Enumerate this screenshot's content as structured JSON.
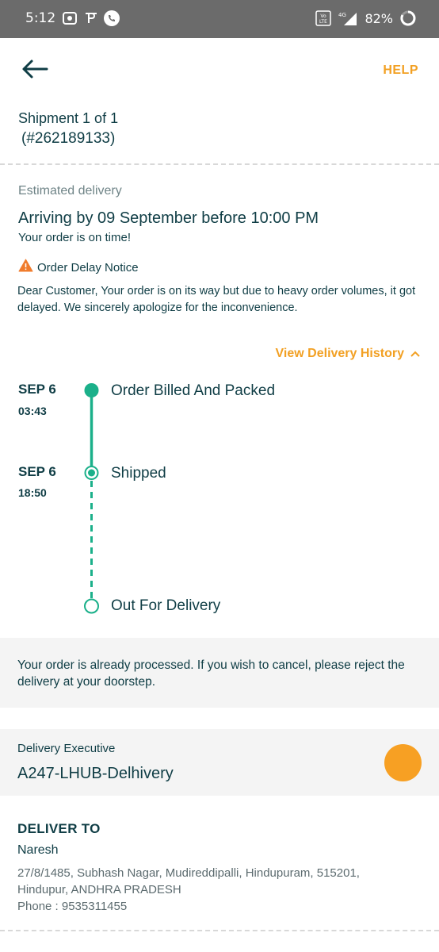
{
  "status_bar": {
    "time": "5:12",
    "battery": "82%",
    "network": "4G"
  },
  "header": {
    "help_label": "HELP"
  },
  "shipment": {
    "line1": "Shipment 1 of 1",
    "line2": "(#262189133)"
  },
  "delivery": {
    "label": "Estimated delivery",
    "arriving": "Arriving by 09 September before 10:00 PM",
    "status": "Your order is on time!"
  },
  "notice": {
    "title": "Order Delay Notice",
    "body": "Dear Customer, Your order is on its way but due to heavy order volumes, it got delayed. We sincerely apologize for the inconvenience."
  },
  "history": {
    "toggle_label": "View Delivery History",
    "steps": [
      {
        "date": "SEP 6",
        "time": "03:43",
        "label": "Order Billed And Packed",
        "state": "done"
      },
      {
        "date": "SEP 6",
        "time": "18:50",
        "label": "Shipped",
        "state": "current"
      },
      {
        "date": "",
        "time": "",
        "label": "Out For Delivery",
        "state": "pending"
      }
    ]
  },
  "cancel_info": "Your order is already processed. If you wish to cancel, please reject the delivery at your doorstep.",
  "executive": {
    "label": "Delivery Executive",
    "name": "A247-LHUB-Delhivery"
  },
  "deliver_to": {
    "heading": "DELIVER TO",
    "name": "Naresh",
    "address": "27/8/1485, Subhash Nagar, Mudireddipalli, Hindupuram, 515201, Hindupur, ANDHRA PRADESH",
    "phone": "Phone : 9535311455"
  },
  "colors": {
    "accent": "#f2a023",
    "teal": "#1bb08a",
    "text": "#0f3d45"
  }
}
